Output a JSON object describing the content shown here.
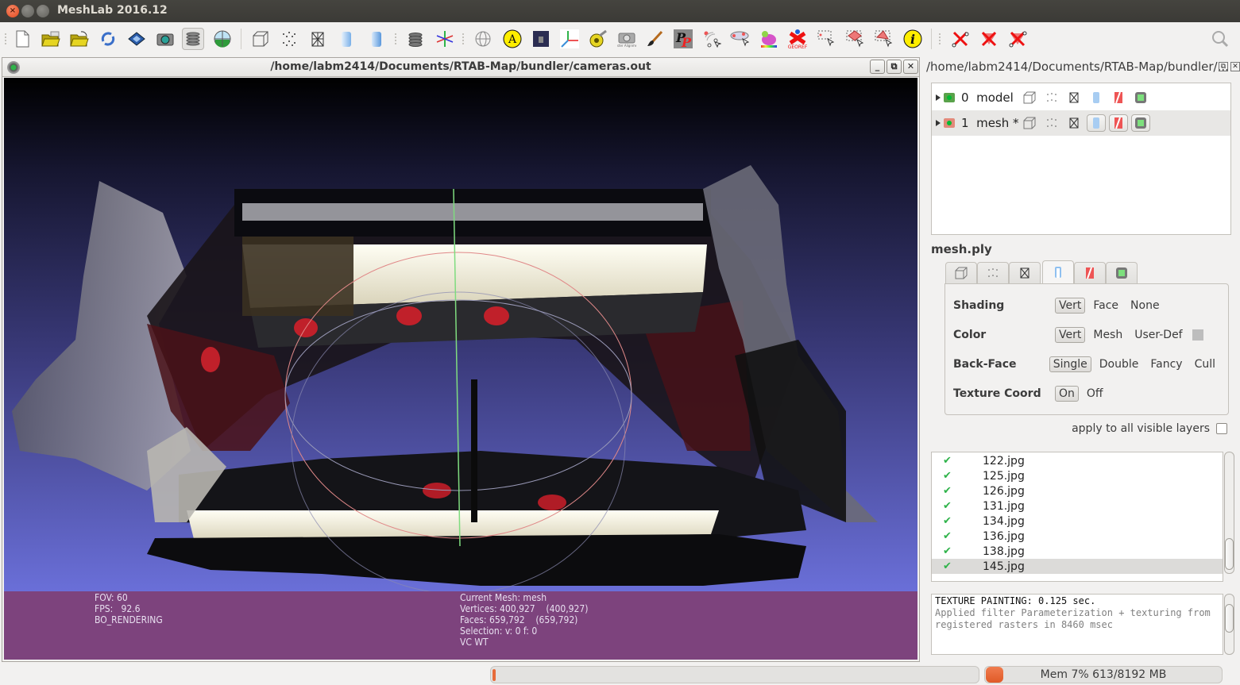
{
  "window": {
    "title": "MeshLab 2016.12",
    "controls": [
      "close",
      "minimize",
      "maximize"
    ]
  },
  "toolbar": {
    "items": [
      {
        "name": "new-project-icon",
        "label": "New Empty Project"
      },
      {
        "name": "open-project-icon",
        "label": "Open Project"
      },
      {
        "name": "import-mesh-icon",
        "label": "Import Mesh"
      },
      {
        "name": "reload-icon",
        "label": "Reload"
      },
      {
        "name": "save-icon",
        "label": "Export Mesh"
      },
      {
        "name": "snapshot-icon",
        "label": "Save Snapshot"
      },
      {
        "name": "layers-icon",
        "label": "Show Layer Dialog",
        "active": true
      },
      {
        "name": "raster-view-icon",
        "label": "Show Raster"
      },
      {
        "name": "bounding-box-icon",
        "label": "Bounding Box"
      },
      {
        "name": "points-icon",
        "label": "Points"
      },
      {
        "name": "wireframe-icon",
        "label": "Wireframe"
      },
      {
        "name": "flat-shading-icon",
        "label": "Flat"
      },
      {
        "name": "smooth-shading-icon",
        "label": "Smooth"
      },
      {
        "name": "layer-stack-icon",
        "label": "Layers"
      },
      {
        "name": "axis-icon",
        "label": "Show Axis"
      },
      {
        "name": "trackball-icon",
        "label": "Trackball"
      },
      {
        "name": "annotation-icon",
        "label": "A"
      },
      {
        "name": "raster-icon",
        "label": "Raster"
      },
      {
        "name": "axes-icon",
        "label": "Axes"
      },
      {
        "name": "measure-icon",
        "label": "Measure"
      },
      {
        "name": "raster-alignment-icon",
        "label": "Raster Alignment"
      },
      {
        "name": "paint-brush-icon",
        "label": "Paint"
      },
      {
        "name": "pickpoints-icon",
        "label": "PickPoints"
      },
      {
        "name": "select-connected-icon",
        "label": "Select Connected"
      },
      {
        "name": "select-region-icon",
        "label": "Select Region"
      },
      {
        "name": "quality-mapper-icon",
        "label": "Quality Mapper"
      },
      {
        "name": "georef-icon",
        "label": "GEOREF"
      },
      {
        "name": "select-vertices-icon",
        "label": "Select Vertices"
      },
      {
        "name": "select-faces-icon",
        "label": "Select Faces"
      },
      {
        "name": "select-faces-area-icon",
        "label": "Select Faces Area"
      },
      {
        "name": "info-icon",
        "label": "i"
      },
      {
        "name": "delete-vertices-icon",
        "label": "Delete Vertices"
      },
      {
        "name": "delete-faces-icon",
        "label": "Delete Faces"
      },
      {
        "name": "delete-faces-vertices-icon",
        "label": "Delete Faces and Vertices"
      }
    ]
  },
  "document": {
    "title": "/home/labm2414/Documents/RTAB-Map/bundler/cameras.out",
    "controls": {
      "minimize": "_",
      "restore": "⧉",
      "close": "✕"
    }
  },
  "viewport": {
    "info_left": [
      "FOV: 60",
      "FPS:   92.6",
      "BO_RENDERING"
    ],
    "info_right": [
      "Current Mesh: mesh",
      "Vertices: 400,927    (400,927)",
      "Faces: 659,792    (659,792)",
      "Selection: v: 0 f: 0",
      "VC WT"
    ]
  },
  "layer_panel": {
    "title": "/home/labm2414/Documents/RTAB-Map/bundler/...",
    "layers": [
      {
        "id": "0",
        "name": "model",
        "selected": false
      },
      {
        "id": "1",
        "name": "mesh *",
        "selected": true
      }
    ],
    "current_mesh_file": "mesh.ply",
    "render_tabs": [
      "bounding-box",
      "points",
      "wireframe",
      "solid",
      "texture",
      "vertex-select"
    ],
    "active_tab": 3,
    "properties": [
      {
        "label": "Shading",
        "options": [
          "Vert",
          "Face",
          "None"
        ],
        "selected": 0
      },
      {
        "label": "Color",
        "options": [
          "Vert",
          "Mesh",
          "User-Def"
        ],
        "selected": 0,
        "swatch": "#bdbdbd"
      },
      {
        "label": "Back-Face",
        "options": [
          "Single",
          "Double",
          "Fancy",
          "Cull"
        ],
        "selected": 0
      },
      {
        "label": "Texture Coord",
        "options": [
          "On",
          "Off"
        ],
        "selected": 0
      }
    ],
    "apply_all_label": "apply to all visible layers",
    "apply_all_checked": false,
    "rasters": [
      {
        "name": "122.jpg",
        "visible": true
      },
      {
        "name": "125.jpg",
        "visible": true
      },
      {
        "name": "126.jpg",
        "visible": true
      },
      {
        "name": "131.jpg",
        "visible": true
      },
      {
        "name": "134.jpg",
        "visible": true
      },
      {
        "name": "136.jpg",
        "visible": true
      },
      {
        "name": "138.jpg",
        "visible": true
      },
      {
        "name": "145.jpg",
        "visible": true,
        "selected": true
      }
    ],
    "log": {
      "line1": "TEXTURE PAINTING: 0.125 sec.",
      "line2": "Applied filter Parameterization + texturing from",
      "line3": "registered rasters in 8460 msec"
    }
  },
  "statusbar": {
    "progress_percent": 0,
    "memory_text": "Mem 7% 613/8192 MB",
    "memory_color": "#e8652f"
  },
  "colors": {
    "infobar": "#7d437d",
    "viewport_top": "#000000",
    "viewport_bottom": "#6a6fd8",
    "check": "#2fb34a"
  }
}
